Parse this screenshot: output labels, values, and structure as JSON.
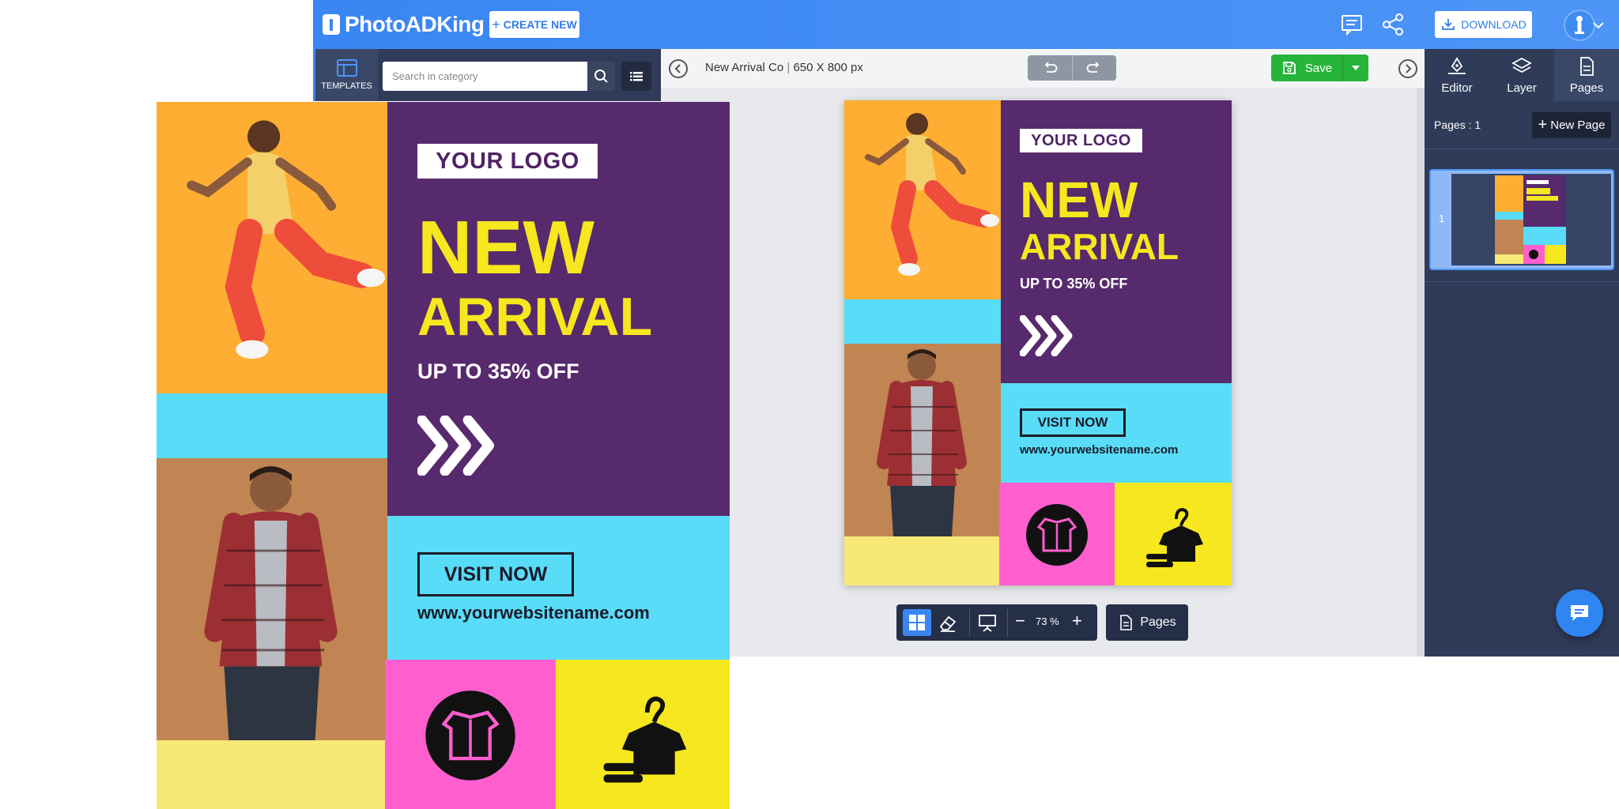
{
  "app": {
    "brand": "PhotoADKing",
    "create_new": "CREATE NEW",
    "download": "DOWNLOAD"
  },
  "left_panel": {
    "templates_tab": "TEMPLATES",
    "search_placeholder": "Search in category"
  },
  "toolbar": {
    "doc_title": "New Arrival Co",
    "doc_size": "650 X 800 px",
    "save_label": "Save"
  },
  "right_panel": {
    "tabs": [
      "Editor",
      "Layer",
      "Pages"
    ],
    "pages_count": "Pages : 1",
    "new_page": "New Page",
    "page_number": "1"
  },
  "view_tools": {
    "zoom": "73 %",
    "pages_label": "Pages"
  },
  "poster": {
    "logo": "YOUR LOGO",
    "headline_1": "NEW",
    "headline_2": "ARRIVAL",
    "offer": "UP TO 35% OFF",
    "cta": "VISIT NOW",
    "website": "www.yourwebsitename.com",
    "colors": {
      "purple": "#562a6c",
      "yellow": "#f6e71f",
      "cyan": "#58dcf7",
      "pink": "#ff5ecf",
      "orange": "#fdae33",
      "tan": "#c08552",
      "pale_yellow": "#f8e875"
    }
  },
  "icons": {
    "brand": "photoadking-logo-icon",
    "feedback": "feedback-icon",
    "share": "share-icon",
    "download": "download-icon",
    "chat": "chat-icon",
    "shirt": "shirt-icon",
    "hanger": "hanger-icon",
    "chevrons": "triple-chevron-icon"
  }
}
